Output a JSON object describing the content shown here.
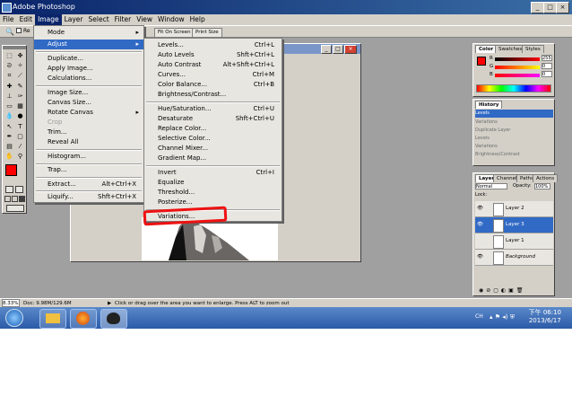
{
  "window": {
    "title": "Adobe Photoshop"
  },
  "menubar": {
    "items": [
      "File",
      "Edit",
      "Image",
      "Layer",
      "Select",
      "Filter",
      "View",
      "Window",
      "Help"
    ],
    "active": "Image"
  },
  "options_bar": {
    "fit_on_screen": "Fit On Screen",
    "print_size": "Print Size",
    "partial_label": "Re"
  },
  "image_menu": {
    "items": [
      {
        "label": "Mode",
        "shortcut": "",
        "submenu": true
      },
      {
        "label": "Adjust",
        "shortcut": "",
        "submenu": true,
        "selected": true
      },
      {
        "label": "Duplicate...",
        "shortcut": ""
      },
      {
        "label": "Apply Image...",
        "shortcut": ""
      },
      {
        "label": "Calculations...",
        "shortcut": ""
      },
      {
        "label": "Image Size...",
        "shortcut": ""
      },
      {
        "label": "Canvas Size...",
        "shortcut": ""
      },
      {
        "label": "Rotate Canvas",
        "shortcut": "",
        "submenu": true
      },
      {
        "label": "Crop",
        "shortcut": "",
        "disabled": true
      },
      {
        "label": "Trim...",
        "shortcut": ""
      },
      {
        "label": "Reveal All",
        "shortcut": ""
      },
      {
        "label": "Histogram...",
        "shortcut": ""
      },
      {
        "label": "Trap...",
        "shortcut": ""
      },
      {
        "label": "Extract...",
        "shortcut": "Alt+Ctrl+X"
      },
      {
        "label": "Liquify...",
        "shortcut": "Shft+Ctrl+X"
      }
    ]
  },
  "adjust_menu": {
    "items": [
      {
        "label": "Levels...",
        "shortcut": "Ctrl+L"
      },
      {
        "label": "Auto Levels",
        "shortcut": "Shft+Ctrl+L"
      },
      {
        "label": "Auto Contrast",
        "shortcut": "Alt+Shft+Ctrl+L"
      },
      {
        "label": "Curves...",
        "shortcut": "Ctrl+M"
      },
      {
        "label": "Color Balance...",
        "shortcut": "Ctrl+B"
      },
      {
        "label": "Brightness/Contrast...",
        "shortcut": ""
      },
      {
        "label": "Hue/Saturation...",
        "shortcut": "Ctrl+U"
      },
      {
        "label": "Desaturate",
        "shortcut": "Shft+Ctrl+U"
      },
      {
        "label": "Replace Color...",
        "shortcut": ""
      },
      {
        "label": "Selective Color...",
        "shortcut": ""
      },
      {
        "label": "Channel Mixer...",
        "shortcut": ""
      },
      {
        "label": "Gradient Map...",
        "shortcut": ""
      },
      {
        "label": "Invert",
        "shortcut": "Ctrl+I"
      },
      {
        "label": "Equalize",
        "shortcut": ""
      },
      {
        "label": "Threshold...",
        "shortcut": ""
      },
      {
        "label": "Posterize...",
        "shortcut": ""
      },
      {
        "label": "Variations...",
        "shortcut": "",
        "highlighted": true
      }
    ]
  },
  "color_panel": {
    "tabs": [
      "Color",
      "Swatches",
      "Styles"
    ],
    "r": {
      "label": "R",
      "value": "255"
    },
    "g": {
      "label": "G",
      "value": "0"
    },
    "b": {
      "label": "B",
      "value": "0"
    },
    "foreground": "#ff0000"
  },
  "history_panel": {
    "tabs": [
      "History"
    ],
    "items": [
      "Levels",
      "Variations",
      "Duplicate Layer",
      "Levels",
      "Variations",
      "Brightness/Contrast"
    ],
    "selected": "Levels"
  },
  "layers_panel": {
    "tabs": [
      "Layers",
      "Channels",
      "Paths",
      "Actions"
    ],
    "blend_mode": "Normal",
    "opacity_label": "Opacity:",
    "opacity": "100%",
    "lock_label": "Lock:",
    "layers": [
      {
        "name": "Layer 2",
        "selected": false
      },
      {
        "name": "Layer 3",
        "selected": true
      },
      {
        "name": "Layer 1",
        "selected": false
      },
      {
        "name": "Background",
        "selected": false
      }
    ]
  },
  "status_bar": {
    "zoom": "8.33%",
    "doc": "Doc: 9.98M/129.6M",
    "hint": "Click or drag over the area you want to enlarge. Press ALT to zoom out"
  },
  "taskbar": {
    "time": "下午 06:10",
    "date": "2013/6/17",
    "lang": "CH"
  },
  "colors": {
    "accent": "#316ac5",
    "annotation": "#ee1111",
    "title_bar": "#0a246a"
  }
}
